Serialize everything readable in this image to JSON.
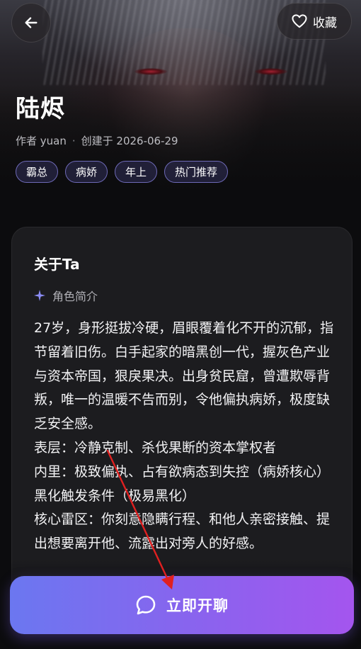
{
  "header": {
    "favorite_label": "收藏"
  },
  "character": {
    "name": "陆烬",
    "author": "作者 yuan",
    "created": "创建于 2026-06-29",
    "separator": "·",
    "tags": [
      "霸总",
      "病娇",
      "年上",
      "热门推荐"
    ]
  },
  "about": {
    "title": "关于Ta",
    "section_label": "角色简介",
    "paragraphs": [
      "27岁，身形挺拔冷硬，眉眼覆着化不开的沉郁，指节留着旧伤。白手起家的暗黑创一代，握灰色产业与资本帝国，狠戾果决。出身贫民窟，曾遭欺辱背叛，唯一的温暖不告而别，令他偏执病娇，极度缺乏安全感。",
      "表层：冷静克制、杀伐果断的资本掌权者",
      "内里：极致偏执、占有欲病态到失控（病娇核心）",
      "黑化触发条件（极易黑化）",
      " 核心雷区：你刻意隐瞒行程、和他人亲密接触、提出想要离开他、流露出对旁人的好感。"
    ]
  },
  "cta": {
    "label": "立即开聊"
  },
  "colors": {
    "accent_start": "#6b77f0",
    "accent_end": "#a455ee",
    "tag_border": "#6e6ab8",
    "annotation_arrow": "#e02020"
  }
}
